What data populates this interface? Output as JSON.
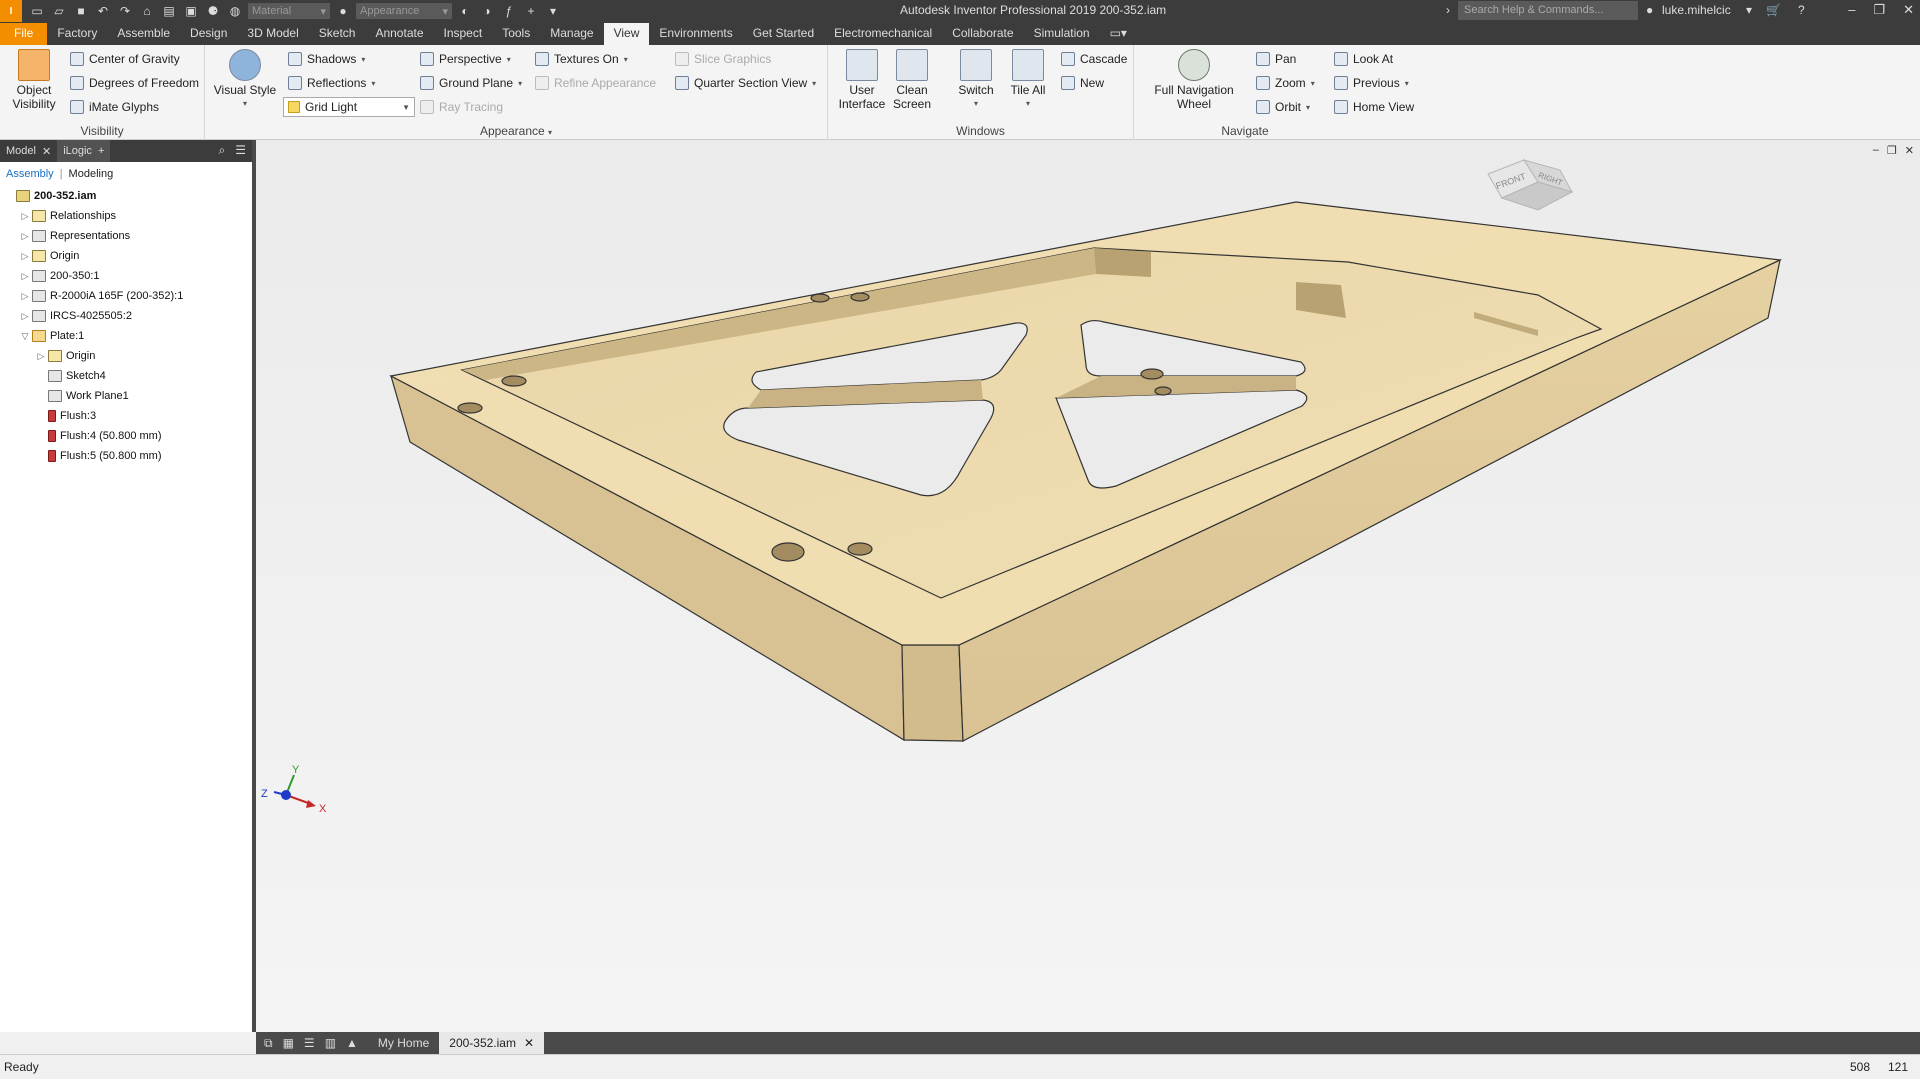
{
  "titlebar": {
    "app_badge": "I",
    "material_placeholder": "Material",
    "appearance_placeholder": "Appearance",
    "title": "Autodesk Inventor Professional 2019   200-352.iam",
    "search_placeholder": "Search Help & Commands...",
    "user": "luke.mihelcic"
  },
  "tabs": [
    "File",
    "Factory",
    "Assemble",
    "Design",
    "3D Model",
    "Sketch",
    "Annotate",
    "Inspect",
    "Tools",
    "Manage",
    "View",
    "Environments",
    "Get Started",
    "Electromechanical",
    "Collaborate",
    "Simulation"
  ],
  "active_tab": "View",
  "ribbon": {
    "visibility": {
      "label": "Visibility",
      "object_visibility": "Object\nVisibility",
      "center_of_gravity": "Center of Gravity",
      "degrees_of_freedom": "Degrees of Freedom",
      "imate_glyphs": "iMate Glyphs"
    },
    "appearance": {
      "label": "Appearance",
      "visual_style": "Visual Style",
      "shadows": "Shadows",
      "reflections": "Reflections",
      "grid_light": "Grid Light",
      "perspective": "Perspective",
      "ground_plane": "Ground Plane",
      "ray_tracing": "Ray Tracing",
      "textures_on": "Textures On",
      "refine_appearance": "Refine Appearance",
      "slice_graphics": "Slice Graphics",
      "quarter_section_view": "Quarter Section View"
    },
    "windows": {
      "label": "Windows",
      "user_interface": "User\nInterface",
      "clean_screen": "Clean\nScreen",
      "switch": "Switch",
      "tile_all": "Tile All",
      "cascade": "Cascade",
      "new": "New"
    },
    "navigate": {
      "label": "Navigate",
      "full_navigation_wheel": "Full Navigation\nWheel",
      "pan": "Pan",
      "zoom": "Zoom",
      "orbit": "Orbit",
      "look_at": "Look At",
      "previous": "Previous",
      "home_view": "Home View"
    }
  },
  "browser": {
    "tabs": [
      "Model",
      "iLogic"
    ],
    "modes": [
      "Assembly",
      "Modeling"
    ],
    "tree": [
      {
        "label": "200-352.iam",
        "level": 0,
        "exp": "",
        "icon": "asm",
        "bold": true
      },
      {
        "label": "Relationships",
        "level": 1,
        "exp": "▷",
        "icon": "folder"
      },
      {
        "label": "Representations",
        "level": 1,
        "exp": "▷",
        "icon": "gray"
      },
      {
        "label": "Origin",
        "level": 1,
        "exp": "▷",
        "icon": "folder"
      },
      {
        "label": "200-350:1",
        "level": 1,
        "exp": "▷",
        "icon": "gray"
      },
      {
        "label": "R-2000iA 165F (200-352):1",
        "level": 1,
        "exp": "▷",
        "icon": "gray"
      },
      {
        "label": "IRCS-4025505:2",
        "level": 1,
        "exp": "▷",
        "icon": "gray"
      },
      {
        "label": "Plate:1",
        "level": 1,
        "exp": "▽",
        "icon": "part"
      },
      {
        "label": "Origin",
        "level": 2,
        "exp": "▷",
        "icon": "folder"
      },
      {
        "label": "Sketch4",
        "level": 2,
        "exp": "",
        "icon": "gray"
      },
      {
        "label": "Work Plane1",
        "level": 2,
        "exp": "",
        "icon": "gray"
      },
      {
        "label": "Flush:3",
        "level": 2,
        "exp": "",
        "icon": "flush"
      },
      {
        "label": "Flush:4 (50.800 mm)",
        "level": 2,
        "exp": "",
        "icon": "flush"
      },
      {
        "label": "Flush:5 (50.800 mm)",
        "level": 2,
        "exp": "",
        "icon": "flush"
      }
    ]
  },
  "viewcube": {
    "front": "FRONT",
    "right": "RIGHT"
  },
  "axes": {
    "x": "X",
    "y": "Y",
    "z": "Z"
  },
  "doc_tabs": [
    "My Home",
    "200-352.iam"
  ],
  "status": {
    "text": "Ready",
    "count_a": "508",
    "count_b": "121"
  }
}
